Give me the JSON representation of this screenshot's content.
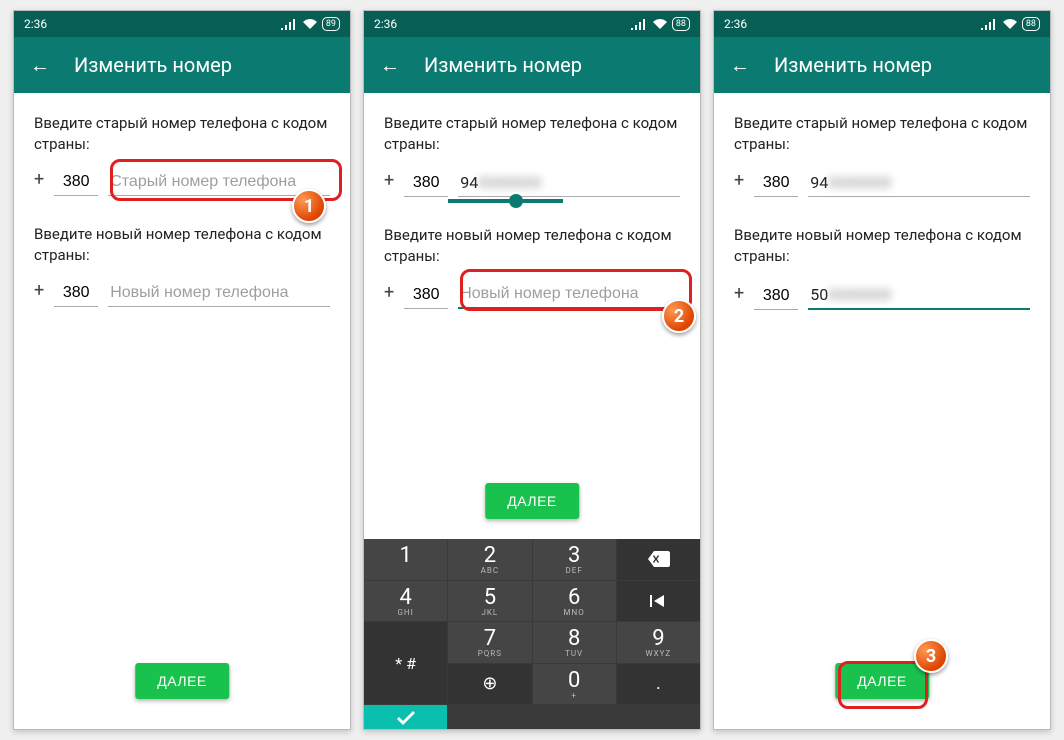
{
  "status": {
    "time": "2:36",
    "battery1": "89",
    "battery2": "88",
    "battery3": "88"
  },
  "toolbar": {
    "title": "Изменить номер"
  },
  "prompts": {
    "old": "Введите старый номер телефона с кодом страны:",
    "new": "Введите новый номер телефона с кодом страны:"
  },
  "fields": {
    "plus": "+",
    "code": "380",
    "old_placeholder": "Старый номер телефона",
    "new_placeholder": "Новый номер телефона",
    "s2_old_prefix": "94",
    "s3_old_prefix": "94",
    "s3_new_prefix": "50"
  },
  "button": {
    "next": "ДАЛЕЕ"
  },
  "keypad": {
    "k1": "1",
    "k2": "2",
    "k3": "3",
    "k4": "4",
    "k5": "5",
    "k6": "6",
    "k7": "7",
    "k8": "8",
    "k9": "9",
    "k0": "0",
    "sub2": "ABC",
    "sub3": "DEF",
    "sub4": "GHI",
    "sub5": "JKL",
    "sub6": "MNO",
    "sub7": "PQRS",
    "sub8": "TUV",
    "sub9": "WXYZ",
    "sub0": "+",
    "sym": "* #",
    "lang": "⊕",
    "comma": ",",
    "period": "."
  },
  "annotations": {
    "b1": "1",
    "b2": "2",
    "b3": "3"
  }
}
